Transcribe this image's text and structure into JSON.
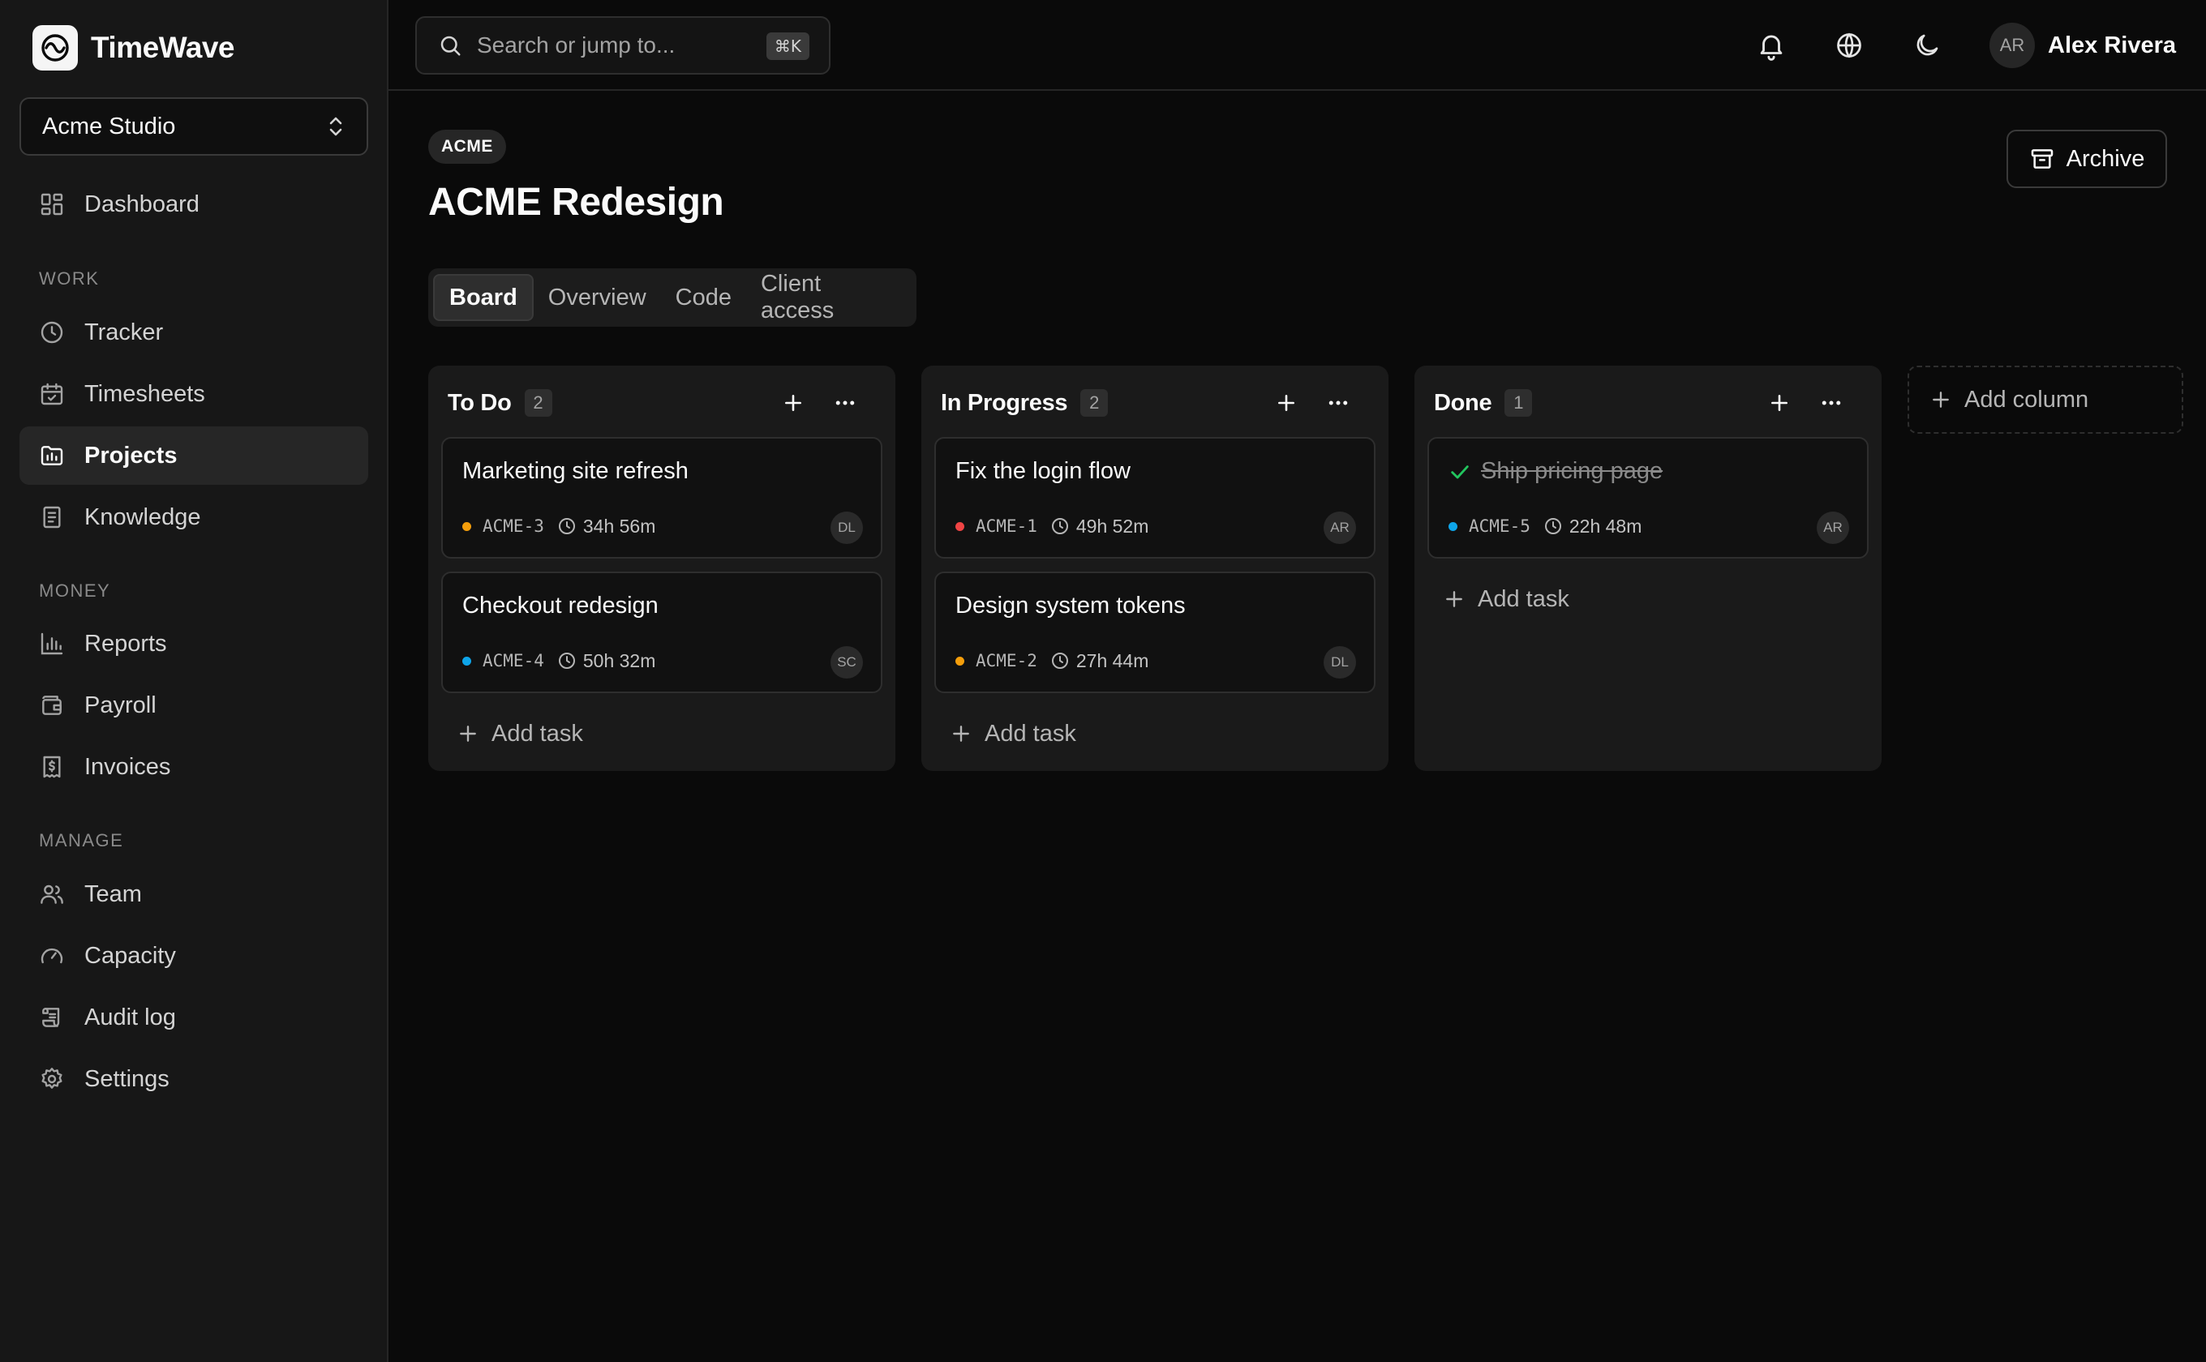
{
  "app": {
    "name": "TimeWave"
  },
  "sidebar": {
    "org": "Acme Studio",
    "items": [
      {
        "label": "Dashboard",
        "icon": "dashboard-icon"
      },
      {
        "label": "Tracker",
        "icon": "clock-icon"
      },
      {
        "label": "Timesheets",
        "icon": "calendar-check-icon"
      },
      {
        "label": "Projects",
        "icon": "folder-chart-icon",
        "active": true
      },
      {
        "label": "Knowledge",
        "icon": "book-icon"
      },
      {
        "label": "Reports",
        "icon": "bar-chart-icon"
      },
      {
        "label": "Payroll",
        "icon": "wallet-icon"
      },
      {
        "label": "Invoices",
        "icon": "receipt-icon"
      },
      {
        "label": "Team",
        "icon": "users-icon"
      },
      {
        "label": "Capacity",
        "icon": "gauge-icon"
      },
      {
        "label": "Audit log",
        "icon": "scroll-icon"
      },
      {
        "label": "Settings",
        "icon": "gear-icon"
      }
    ],
    "sections": {
      "work": "Work",
      "money": "Money",
      "manage": "Manage"
    }
  },
  "topbar": {
    "search_placeholder": "Search or jump to...",
    "search_shortcut": "⌘K",
    "user": {
      "initials": "AR",
      "name": "Alex Rivera"
    }
  },
  "project": {
    "key_badge": "ACME",
    "title": "ACME Redesign",
    "archive_label": "Archive"
  },
  "tabs": [
    {
      "label": "Board",
      "active": true
    },
    {
      "label": "Overview"
    },
    {
      "label": "Code"
    },
    {
      "label": "Client access"
    }
  ],
  "board": {
    "add_task_label": "Add task",
    "add_column_label": "Add column",
    "columns": [
      {
        "title": "To Do",
        "count": "2",
        "cards": [
          {
            "title": "Marketing site refresh",
            "key": "ACME-3",
            "time": "34h 56m",
            "assignee": "DL",
            "priority_color": "#f59e0b"
          },
          {
            "title": "Checkout redesign",
            "key": "ACME-4",
            "time": "50h 32m",
            "assignee": "SC",
            "priority_color": "#0ea5e9"
          }
        ]
      },
      {
        "title": "In Progress",
        "count": "2",
        "cards": [
          {
            "title": "Fix the login flow",
            "key": "ACME-1",
            "time": "49h 52m",
            "assignee": "AR",
            "priority_color": "#ef4444"
          },
          {
            "title": "Design system tokens",
            "key": "ACME-2",
            "time": "27h 44m",
            "assignee": "DL",
            "priority_color": "#f59e0b"
          }
        ]
      },
      {
        "title": "Done",
        "count": "1",
        "cards": [
          {
            "title": "Ship pricing page",
            "key": "ACME-5",
            "time": "22h 48m",
            "assignee": "AR",
            "priority_color": "#0ea5e9",
            "done": true
          }
        ]
      }
    ]
  },
  "colors": {
    "background": "#0a0a0a",
    "sidebar": "#171717",
    "done_check": "#22c55e"
  }
}
